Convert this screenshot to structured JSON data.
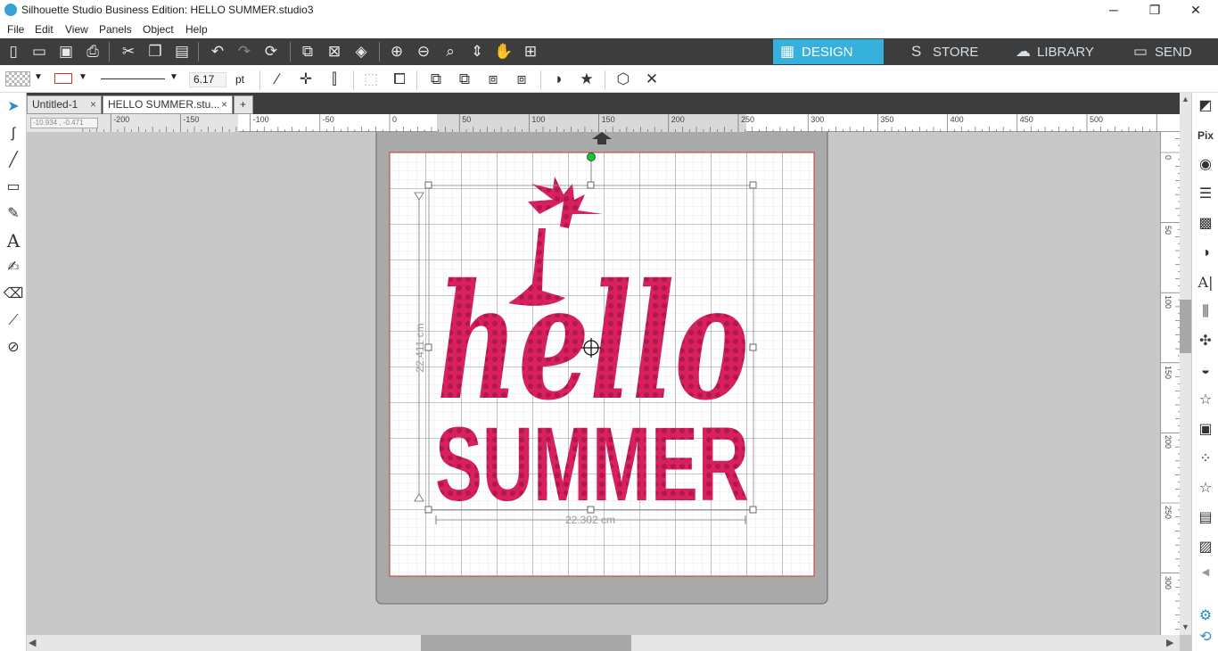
{
  "window": {
    "title": "Silhouette Studio Business Edition: HELLO SUMMER.studio3",
    "minimize": "─",
    "restore": "❐",
    "close": "✕"
  },
  "menu": [
    "File",
    "Edit",
    "View",
    "Panels",
    "Object",
    "Help"
  ],
  "toolbar": {
    "line_width_value": "6.17",
    "line_width_unit": "pt"
  },
  "nav_tabs": [
    {
      "label": "DESIGN",
      "icon": "grid-icon",
      "glyph": "▦"
    },
    {
      "label": "STORE",
      "icon": "store-s-icon",
      "glyph": "S"
    },
    {
      "label": "LIBRARY",
      "icon": "cloud-icon",
      "glyph": "☁"
    },
    {
      "label": "SEND",
      "icon": "cutter-icon",
      "glyph": "▭"
    }
  ],
  "doc_tabs": [
    {
      "label": "Untitled-1",
      "close": "×"
    },
    {
      "label": "HELLO SUMMER.stu...",
      "close": "×"
    },
    {
      "label": "+"
    }
  ],
  "ruler_readout": "-10.934 , -0.471",
  "h_ruler_labels": [
    "-200",
    "-150",
    "-100",
    "-50",
    "0",
    "50",
    "100",
    "150",
    "200",
    "250",
    "300",
    "350",
    "400",
    "450",
    "500"
  ],
  "v_ruler_labels": [
    "0",
    "50",
    "100",
    "150",
    "200",
    "250",
    "300"
  ],
  "design": {
    "line1": "hello",
    "line2": "SUMMER",
    "width_label": "22.302 cm",
    "height_label": "22.411 cm",
    "fill_color": "#d8205e",
    "dot_color": "#b0174b"
  },
  "colors": {
    "accent": "#36b1db",
    "toolbar": "#3d3d3d",
    "mat": "#a9a9a9",
    "selection_handle_rotate": "#18c23a"
  },
  "right_panel_icons": [
    "page-setup-icon",
    "pixscan-icon",
    "fill-color-icon",
    "line-style-icon",
    "texture-icon",
    "image-effects-icon",
    "text-style-icon",
    "align-icon",
    "replicate-icon",
    "modify-icon",
    "offset-icon",
    "trace-icon",
    "transform-icon",
    "sketch-icon",
    "rhinestone-icon",
    "library-icon",
    "settings-icon"
  ]
}
